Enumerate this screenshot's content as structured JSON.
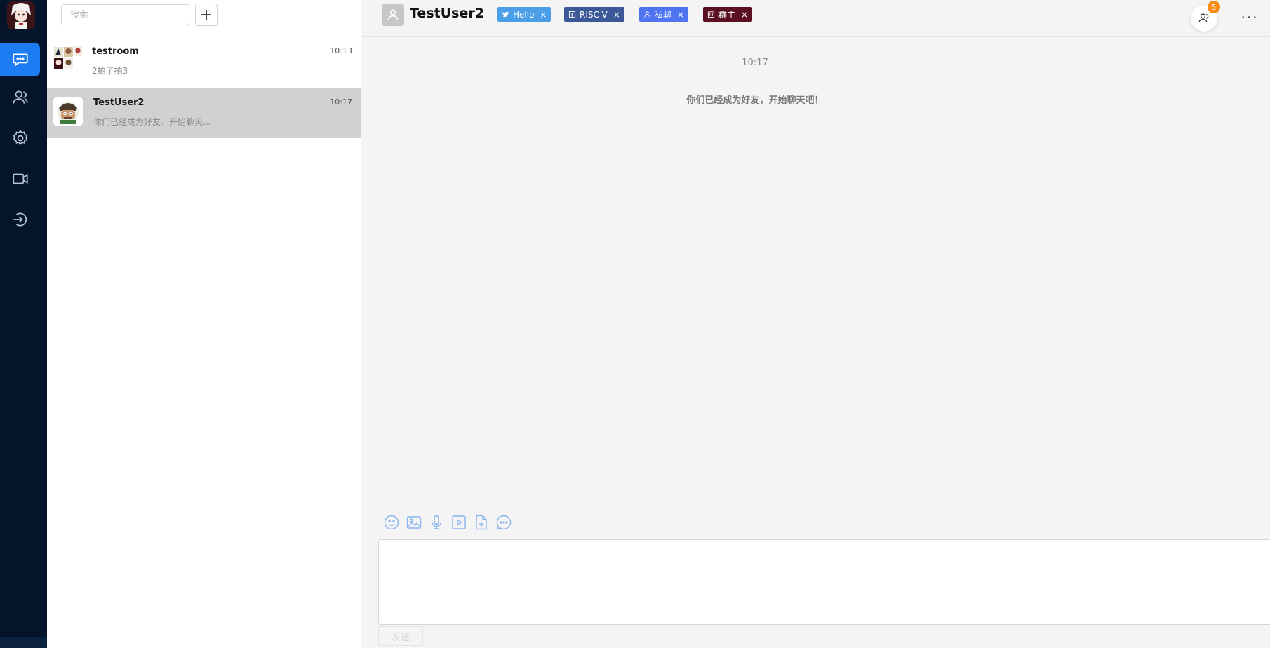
{
  "colors": {
    "rail_bg": "#04152b",
    "accent": "#1d7cf2",
    "selected_row": "#d1d1d1",
    "tag_twitter": "#4a9fe8",
    "tag_facebook": "#3b5898",
    "tag_private": "#4e74f2",
    "tag_owner": "#5a0f24",
    "badge": "#fa8c16",
    "tool_icon": "#8ab4ee"
  },
  "rail": {
    "items": [
      {
        "icon": "chat-icon",
        "active": true
      },
      {
        "icon": "contacts-icon",
        "active": false
      },
      {
        "icon": "gear-icon",
        "active": false
      },
      {
        "icon": "video-camera-icon",
        "active": false
      },
      {
        "icon": "logout-icon",
        "active": false
      }
    ]
  },
  "search": {
    "placeholder": "搜索",
    "add_label": "+"
  },
  "conversations": [
    {
      "name": "testroom",
      "time": "10:13",
      "preview": "2拍了拍3",
      "selected": false
    },
    {
      "name": "TestUser2",
      "time": "10:17",
      "preview": "你们已经成为好友，开始聊天...",
      "selected": true
    }
  ],
  "chat": {
    "peer_name": "TestUser2",
    "tags": [
      {
        "label": "Hello",
        "icon": "twitter-icon",
        "close": "×"
      },
      {
        "label": "RISC-V",
        "icon": "facebook-icon",
        "close": "×"
      },
      {
        "label": "私聊",
        "icon": "user-icon",
        "close": "×"
      },
      {
        "label": "群主",
        "icon": "calendar-icon",
        "close": "×"
      }
    ],
    "member_count": "5",
    "more_label": "···",
    "messages": {
      "time": "10:17",
      "system": "你们已经成为好友，开始聊天吧！"
    },
    "tools": [
      "emoji-icon",
      "image-icon",
      "microphone-icon",
      "video-icon",
      "file-icon",
      "more-chat-icon"
    ],
    "send_label": "发送"
  }
}
